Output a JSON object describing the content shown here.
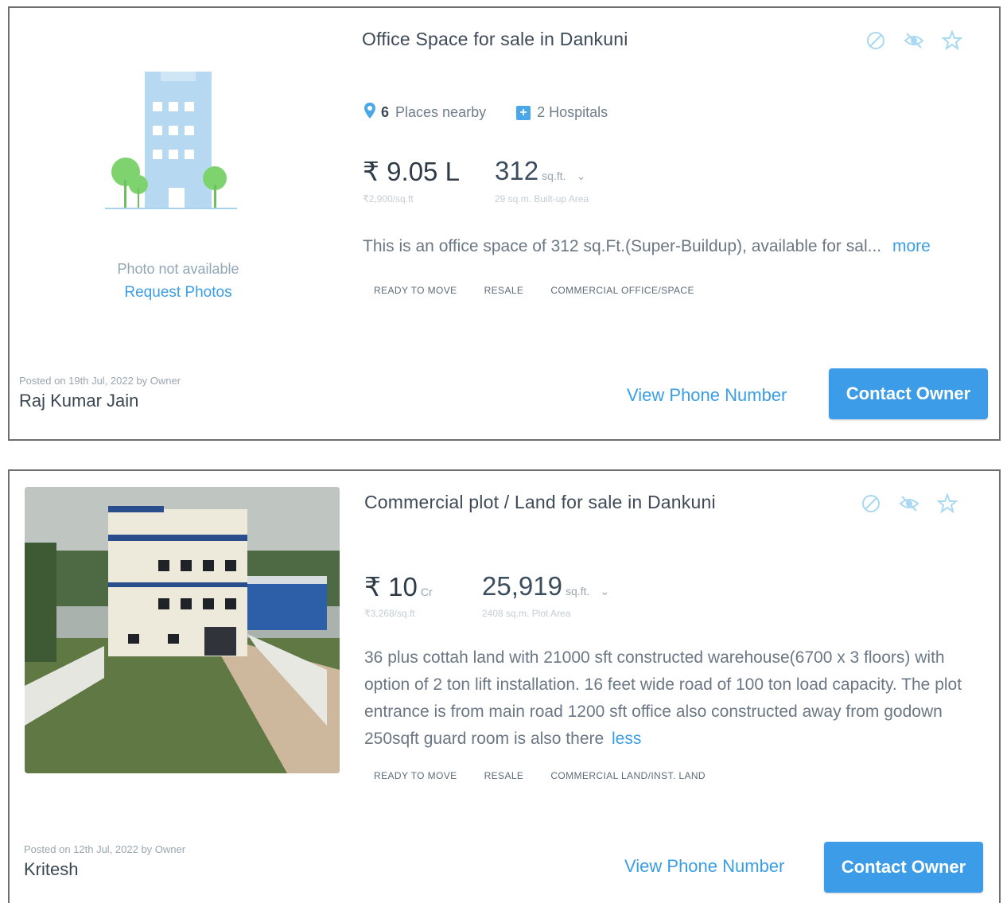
{
  "listings": [
    {
      "title": "Office Space for sale in Dankuni",
      "places_count": "6",
      "places_label": "Places nearby",
      "hospitals_label": "2 Hospitals",
      "price_symbol": "₹",
      "price": "9.05 L",
      "price_per_unit": "₹2,900/sq.ft",
      "area_value": "312",
      "area_unit": "sq.ft.",
      "area_sub": "29 sq.m.  Built-up Area",
      "description": "This is an office space of 312 sq.Ft.(Super-Buildup), available for sal...",
      "more_link": "more",
      "tags": [
        "READY TO MOVE",
        "RESALE",
        "COMMERCIAL OFFICE/SPACE"
      ],
      "photo_text": "Photo not available",
      "request_photos": "Request Photos",
      "posted": "Posted on 19th Jul, 2022 by Owner",
      "owner_name": "Raj Kumar Jain",
      "view_phone": "View Phone Number",
      "contact": "Contact Owner"
    },
    {
      "title": "Commercial plot / Land for sale in Dankuni",
      "price_symbol": "₹",
      "price": "10",
      "price_unit": "Cr",
      "price_per_unit": "₹3,268/sq.ft",
      "area_value": "25,919",
      "area_unit": "sq.ft.",
      "area_sub": "2408 sq.m.  Plot Area",
      "description": "36 plus cottah land with 21000 sft constructed warehouse(6700 x 3 floors) with option of 2 ton lift installation. 16 feet wide road of 100 ton load capacity. The plot entrance is from main road 1200 sft office also constructed away from godown 250sqft guard room is also there",
      "less_link": "less",
      "tags": [
        "READY TO MOVE",
        "RESALE",
        "COMMERCIAL LAND/INST. LAND"
      ],
      "posted": "Posted on 12th Jul, 2022 by Owner",
      "owner_name": "Kritesh",
      "view_phone": "View Phone Number",
      "contact": "Contact Owner"
    }
  ],
  "icons": [
    "block-icon",
    "hide-icon",
    "star-icon",
    "location-pin-icon",
    "hospital-icon",
    "building-illustration",
    "chevron-down-icon"
  ],
  "colors": {
    "accent": "#3d9ce8",
    "link": "#3a9ee6",
    "text": "#3e4a57"
  }
}
